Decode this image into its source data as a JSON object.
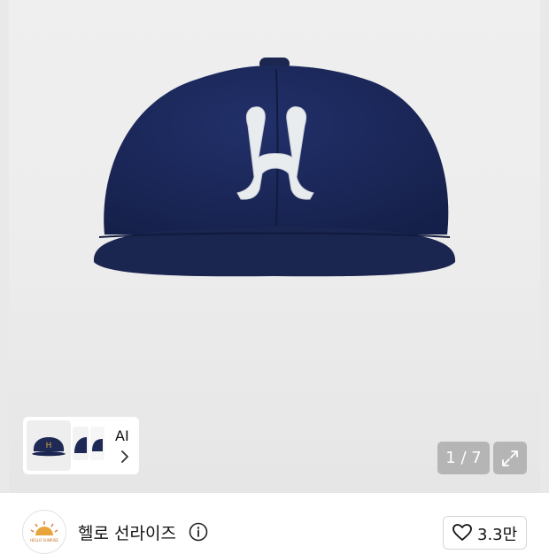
{
  "gallery": {
    "counter": "1 / 7",
    "ai_label": "AI",
    "product_mark": "H"
  },
  "brand": {
    "name": "헬로 선라이즈",
    "avatar_text": "HELLO SUNRISE",
    "like_count": "3.3만"
  },
  "colors": {
    "cap_navy": "#1e2a55",
    "patch": "#e9ecef",
    "thumb_mark": "#d7a13a"
  }
}
